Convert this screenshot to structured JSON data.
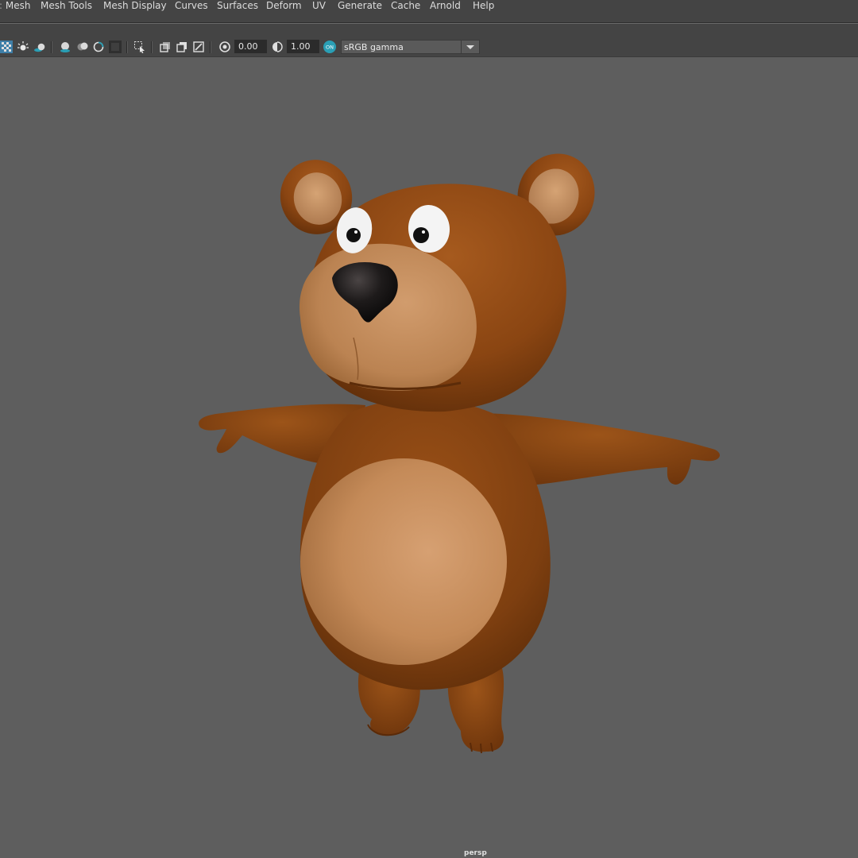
{
  "menubar": {
    "items": [
      "Mesh",
      "Mesh Tools",
      "Mesh Display",
      "Curves",
      "Surfaces",
      "Deform",
      "UV",
      "Generate",
      "Cache",
      "Arnold",
      "Help"
    ]
  },
  "toolbar": {
    "exposure_value": "0.00",
    "gamma_value": "1.00",
    "color_management_badge": "ON",
    "color_space": "sRGB gamma"
  },
  "viewport": {
    "camera_label": "persp",
    "subject": "bear-model"
  },
  "colors": {
    "fur": "#8a4512",
    "belly": "#c98f5e",
    "nose": "#1c1a1a",
    "background": "#5e5e5e",
    "accent": "#2a9fb5"
  }
}
